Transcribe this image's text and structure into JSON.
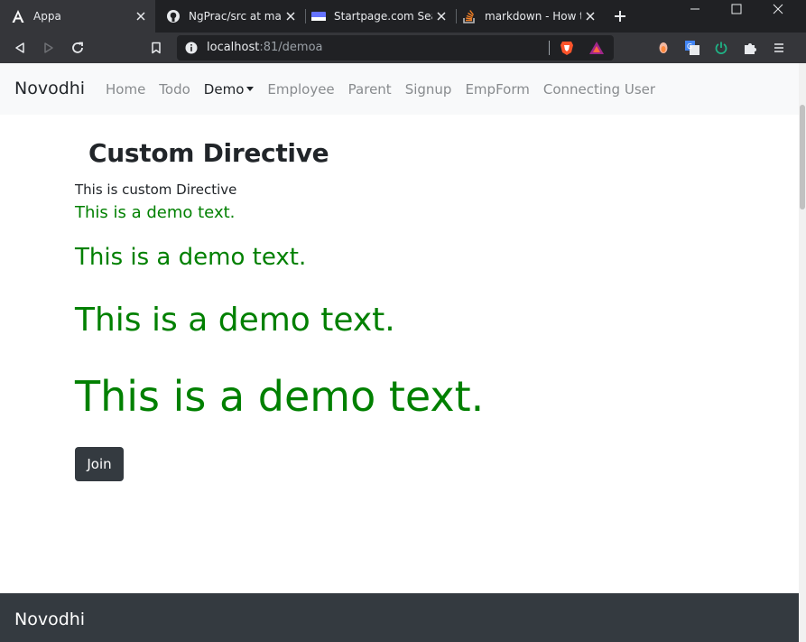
{
  "browser": {
    "tabs": [
      {
        "title": "Appa",
        "active": true
      },
      {
        "title": "NgPrac/src at master",
        "active": false
      },
      {
        "title": "Startpage.com Search",
        "active": false
      },
      {
        "title": "markdown - How to",
        "active": false
      }
    ],
    "url_host": "localhost",
    "url_rest": ":81/demoa"
  },
  "navbar": {
    "brand": "Novodhi",
    "links": [
      "Home",
      "Todo",
      "Demo",
      "Employee",
      "Parent",
      "Signup",
      "EmpForm",
      "Connecting User"
    ]
  },
  "main": {
    "heading": "Custom Directive",
    "paragraph": "This is custom Directive",
    "demo_texts": [
      "This is a demo text.",
      "This is a demo text.",
      "This is a demo text.",
      "This is a demo text."
    ],
    "demo_color": "#008000",
    "join_label": "Join"
  },
  "footer": {
    "brand": "Novodhi"
  },
  "colors": {
    "chrome_dark": "#202124",
    "chrome_toolbar": "#35363a",
    "navbar_bg": "#f8f9fa",
    "footer_bg": "#343a40",
    "button_bg": "#343a40"
  }
}
